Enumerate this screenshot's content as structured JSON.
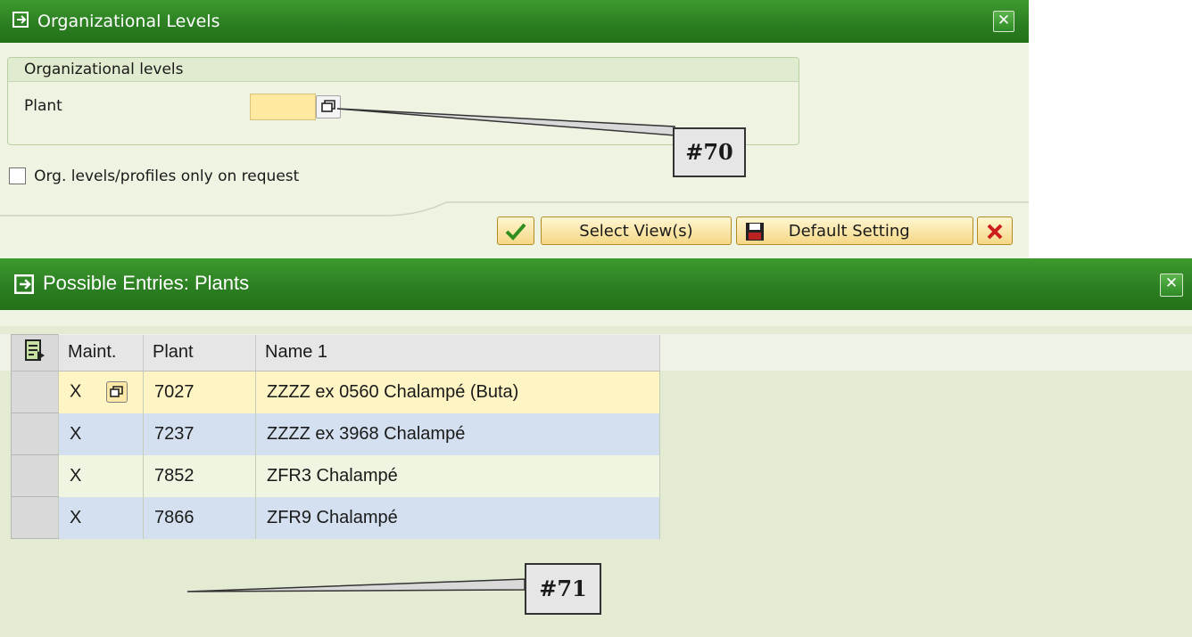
{
  "dialog1": {
    "title": "Organizational Levels",
    "group_title": "Organizational levels",
    "plant_label": "Plant",
    "plant_value": "",
    "checkbox_label": "Org. levels/profiles only on request",
    "checkbox_checked": false,
    "buttons": {
      "select_views": "Select View(s)",
      "default_setting": "Default Setting"
    }
  },
  "dialog2": {
    "title": "Possible Entries: Plants",
    "columns": [
      "Maint.",
      "Plant",
      "Name 1"
    ],
    "rows": [
      {
        "maint": "X",
        "plant": "7027",
        "name": "ZZZZ ex 0560 Chalampé (Buta)"
      },
      {
        "maint": "X",
        "plant": "7237",
        "name": "ZZZZ ex 3968 Chalampé"
      },
      {
        "maint": "X",
        "plant": "7852",
        "name": "ZFR3 Chalampé"
      },
      {
        "maint": "X",
        "plant": "7866",
        "name": "ZFR9 Chalampé"
      }
    ]
  },
  "callouts": {
    "a": "#70",
    "b": "#71"
  },
  "colors": {
    "titlebar": "#2c7f22",
    "input_required": "#ffe8a0",
    "row_alt": "#d4e0f0"
  }
}
